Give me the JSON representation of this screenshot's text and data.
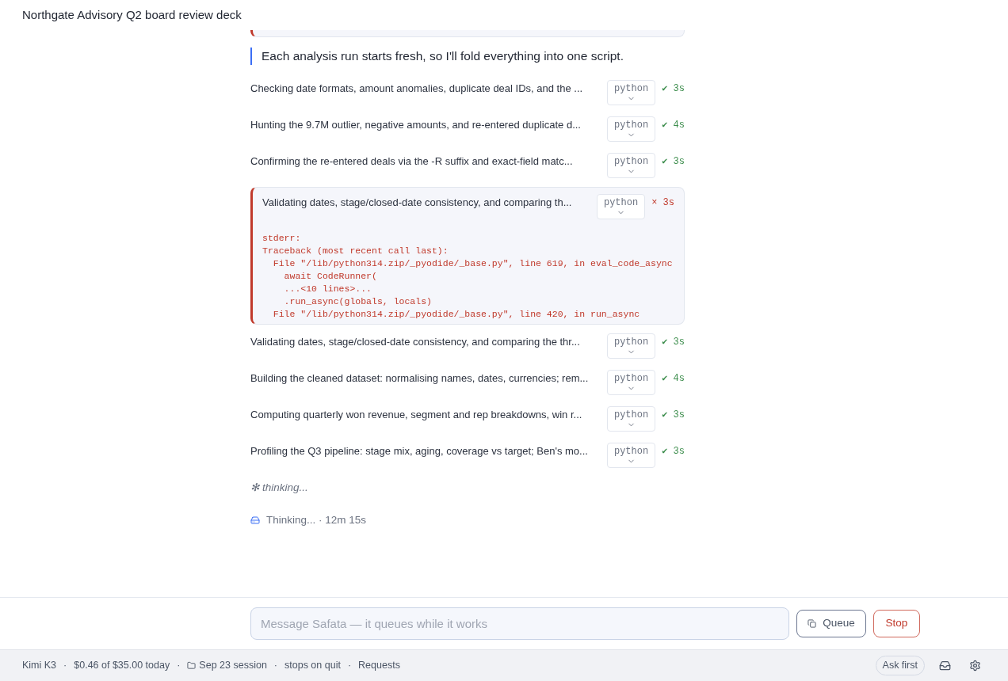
{
  "window": {
    "title": "Northgate Advisory Q2 board review deck"
  },
  "note": "Each analysis run starts fresh, so I'll fold everything into one script.",
  "steps": [
    {
      "text": "Checking date formats, amount anomalies, duplicate deal IDs, and the ...",
      "language": "python",
      "failed": false,
      "mark": "✔",
      "duration": "3s"
    },
    {
      "text": "Hunting the 9.7M outlier, negative amounts, and re-entered duplicate d...",
      "language": "python",
      "failed": false,
      "mark": "✔",
      "duration": "4s"
    },
    {
      "text": "Confirming the re-entered deals via the -R suffix and exact-field matc...",
      "language": "python",
      "failed": false,
      "mark": "✔",
      "duration": "3s"
    },
    {
      "text": "Validating dates, stage/closed-date consistency, and comparing th...",
      "language": "python",
      "failed": true,
      "mark": "×",
      "duration": "3s",
      "output": [
        "stderr:",
        "Traceback (most recent call last):",
        "  File \"/lib/python314.zip/_pyodide/_base.py\", line 619, in eval_code_async",
        "    await CodeRunner(",
        "    ...<10 lines>...",
        "    .run_async(globals, locals)",
        "  File \"/lib/python314.zip/_pyodide/_base.py\", line 420, in run_async"
      ]
    },
    {
      "text": "Validating dates, stage/closed-date consistency, and comparing the thr...",
      "language": "python",
      "failed": false,
      "mark": "✔",
      "duration": "3s"
    },
    {
      "text": "Building the cleaned dataset: normalising names, dates, currencies; rem...",
      "language": "python",
      "failed": false,
      "mark": "✔",
      "duration": "4s"
    },
    {
      "text": "Computing quarterly won revenue, segment and rep breakdowns, win r...",
      "language": "python",
      "failed": false,
      "mark": "✔",
      "duration": "3s"
    },
    {
      "text": "Profiling the Q3 pipeline: stage mix, aging, coverage vs target; Ben's mo...",
      "language": "python",
      "failed": false,
      "mark": "✔",
      "duration": "3s"
    }
  ],
  "thinking": {
    "glyph": "✻",
    "text": "thinking..."
  },
  "activity": "Thinking... · 12m 15s",
  "composer": {
    "placeholder": "Message Safata — it queues while it works",
    "queue": "Queue",
    "stop": "Stop"
  },
  "status_bar": {
    "items": [
      {
        "kind": "text",
        "text": "Kimi K3"
      },
      {
        "kind": "text",
        "text": "$0.46 of $35.00 today"
      },
      {
        "kind": "folder",
        "text": "Sep 23 session"
      },
      {
        "kind": "text",
        "text": "stops on quit"
      },
      {
        "kind": "link",
        "text": "Requests"
      }
    ],
    "separator": "·",
    "mode": "Ask first"
  }
}
